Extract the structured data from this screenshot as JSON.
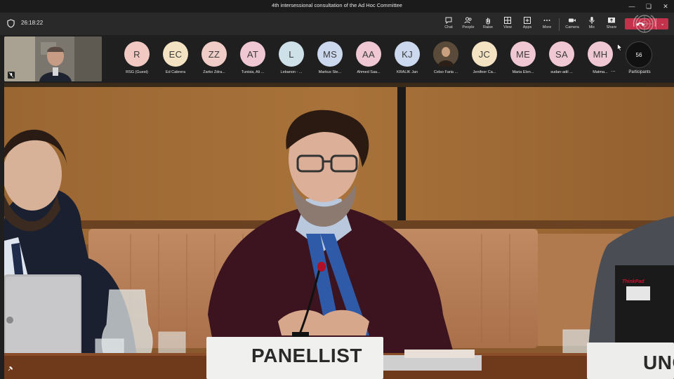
{
  "window": {
    "title": "4th intersessional consultation of the Ad Hoc Committee"
  },
  "toolbar": {
    "timer": "26:18:22",
    "buttons": [
      {
        "label": "Chat",
        "icon": "chat-icon"
      },
      {
        "label": "People",
        "icon": "people-icon"
      },
      {
        "label": "Raise",
        "icon": "raise-hand-icon"
      },
      {
        "label": "View",
        "icon": "view-grid-icon"
      },
      {
        "label": "Apps",
        "icon": "apps-icon"
      },
      {
        "label": "More",
        "icon": "more-icon"
      },
      {
        "label": "Camera",
        "icon": "camera-icon"
      },
      {
        "label": "Mic",
        "icon": "mic-icon"
      },
      {
        "label": "Share",
        "icon": "share-icon"
      }
    ],
    "leave_color": "#c4314b"
  },
  "participants": [
    {
      "initials": "R",
      "name": "RSG (Guest)",
      "color": "#f2c9c2"
    },
    {
      "initials": "EC",
      "name": "Ed Cabrera",
      "color": "#f3e3c3"
    },
    {
      "initials": "ZZ",
      "name": "Zarko Zdra...",
      "color": "#f1cdc8"
    },
    {
      "initials": "AT",
      "name": "Tunisia, Ali ...",
      "color": "#f0c8d4"
    },
    {
      "initials": "L",
      "name": "Lebanon - ...",
      "color": "#cfe1e8"
    },
    {
      "initials": "MS",
      "name": "Markus Ste...",
      "color": "#cbd8ee"
    },
    {
      "initials": "AA",
      "name": "Ahmed Saa...",
      "color": "#f0c8d4"
    },
    {
      "initials": "KJ",
      "name": "KRALIK Jan",
      "color": "#cbd8ee"
    },
    {
      "initials": "",
      "name": "Celso Faria ...",
      "color": "#5a4a3a",
      "photo": true
    },
    {
      "initials": "JC",
      "name": "Jenifeer Ca...",
      "color": "#f3e3c3"
    },
    {
      "initials": "ME",
      "name": "Maria Elen...",
      "color": "#f0c8d4"
    },
    {
      "initials": "SA",
      "name": "sudan-adil ...",
      "color": "#f0c8d4"
    },
    {
      "initials": "MH",
      "name": "Matma...",
      "color": "#f0c8d4"
    }
  ],
  "participants_count": "56",
  "participants_label": "Participants",
  "overflow_label": "...",
  "video": {
    "nameplate_center": "PANELLIST",
    "nameplate_right": "UNO",
    "laptop_brand": "ThinkPad"
  }
}
